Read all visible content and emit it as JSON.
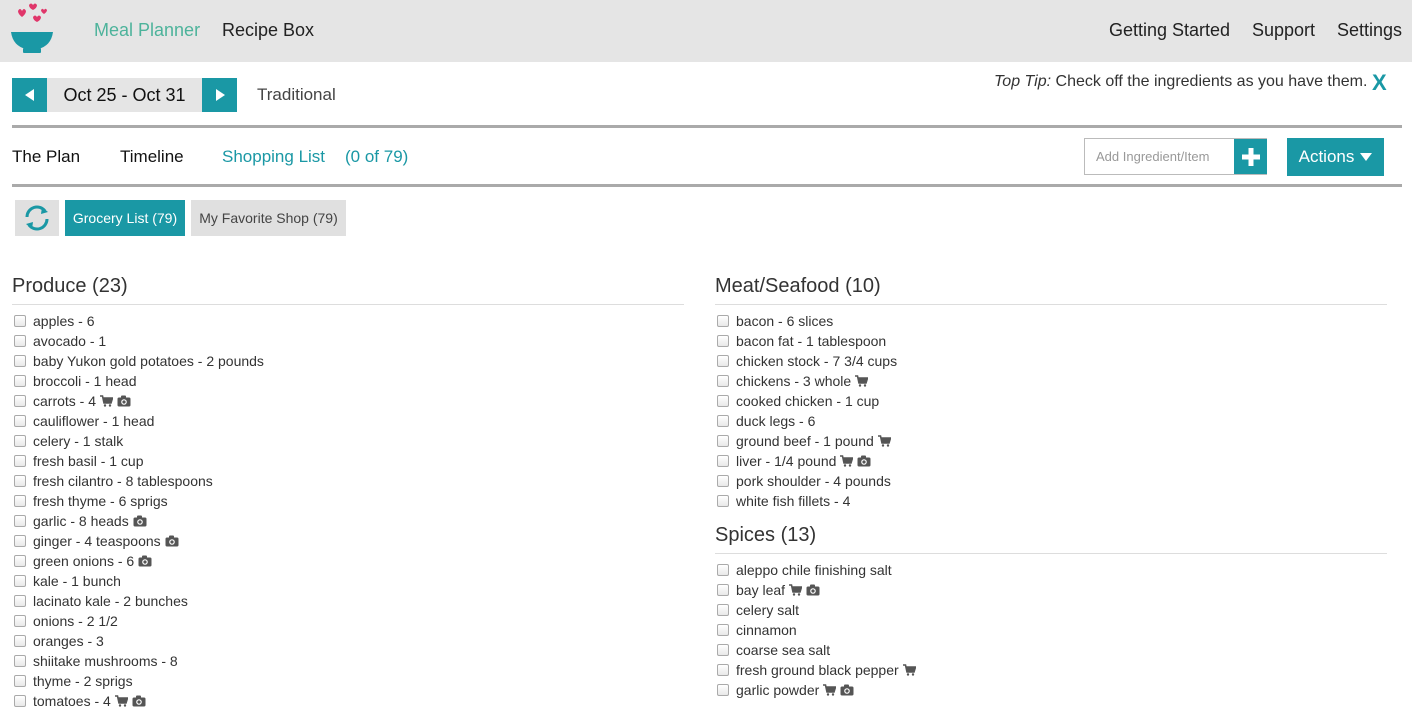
{
  "nav": {
    "meal_planner": "Meal Planner",
    "recipe_box": "Recipe Box",
    "getting_started": "Getting Started",
    "support": "Support",
    "settings": "Settings"
  },
  "week": {
    "range": "Oct 25 - Oct 31",
    "plan_type": "Traditional"
  },
  "tip": {
    "label": "Top Tip:",
    "text": "Check off the ingredients as you have them.",
    "close": "X"
  },
  "tabs": {
    "plan": "The Plan",
    "timeline": "Timeline",
    "shopping_list": "Shopping List",
    "shopping_count": "(0 of 79)"
  },
  "add_item": {
    "placeholder": "Add Ingredient/Item"
  },
  "actions": {
    "label": "Actions"
  },
  "filters": {
    "grocery": "Grocery List (79)",
    "shop": "My Favorite Shop (79)"
  },
  "colors": {
    "accent": "#1a98a5",
    "nav_active": "#4db39b",
    "heart": "#e0366a"
  },
  "sections": {
    "produce": {
      "title": "Produce (23)",
      "items": [
        {
          "text": "apples - 6",
          "cart": false,
          "camera": false
        },
        {
          "text": "avocado - 1",
          "cart": false,
          "camera": false
        },
        {
          "text": "baby Yukon gold potatoes - 2 pounds",
          "cart": false,
          "camera": false
        },
        {
          "text": "broccoli - 1 head",
          "cart": false,
          "camera": false
        },
        {
          "text": "carrots - 4",
          "cart": true,
          "camera": true
        },
        {
          "text": "cauliflower - 1 head",
          "cart": false,
          "camera": false
        },
        {
          "text": "celery - 1 stalk",
          "cart": false,
          "camera": false
        },
        {
          "text": "fresh basil - 1 cup",
          "cart": false,
          "camera": false
        },
        {
          "text": "fresh cilantro - 8 tablespoons",
          "cart": false,
          "camera": false
        },
        {
          "text": "fresh thyme - 6 sprigs",
          "cart": false,
          "camera": false
        },
        {
          "text": "garlic - 8 heads",
          "cart": false,
          "camera": true
        },
        {
          "text": "ginger - 4 teaspoons",
          "cart": false,
          "camera": true
        },
        {
          "text": "green onions - 6",
          "cart": false,
          "camera": true
        },
        {
          "text": "kale - 1 bunch",
          "cart": false,
          "camera": false
        },
        {
          "text": "lacinato kale - 2 bunches",
          "cart": false,
          "camera": false
        },
        {
          "text": "onions - 2 1/2",
          "cart": false,
          "camera": false
        },
        {
          "text": "oranges - 3",
          "cart": false,
          "camera": false
        },
        {
          "text": "shiitake mushrooms - 8",
          "cart": false,
          "camera": false
        },
        {
          "text": "thyme - 2 sprigs",
          "cart": false,
          "camera": false
        },
        {
          "text": "tomatoes - 4",
          "cart": true,
          "camera": true
        }
      ]
    },
    "meat": {
      "title": "Meat/Seafood (10)",
      "items": [
        {
          "text": "bacon - 6 slices",
          "cart": false,
          "camera": false
        },
        {
          "text": "bacon fat - 1 tablespoon",
          "cart": false,
          "camera": false
        },
        {
          "text": "chicken stock - 7 3/4 cups",
          "cart": false,
          "camera": false
        },
        {
          "text": "chickens - 3 whole",
          "cart": true,
          "camera": false
        },
        {
          "text": "cooked chicken - 1 cup",
          "cart": false,
          "camera": false
        },
        {
          "text": "duck legs - 6",
          "cart": false,
          "camera": false
        },
        {
          "text": "ground beef - 1 pound",
          "cart": true,
          "camera": false
        },
        {
          "text": "liver - 1/4 pound",
          "cart": true,
          "camera": true
        },
        {
          "text": "pork shoulder - 4 pounds",
          "cart": false,
          "camera": false
        },
        {
          "text": "white fish fillets - 4",
          "cart": false,
          "camera": false
        }
      ]
    },
    "spices": {
      "title": "Spices (13)",
      "items": [
        {
          "text": "aleppo chile finishing salt",
          "cart": false,
          "camera": false
        },
        {
          "text": "bay leaf",
          "cart": true,
          "camera": true
        },
        {
          "text": "celery salt",
          "cart": false,
          "camera": false
        },
        {
          "text": "cinnamon",
          "cart": false,
          "camera": false
        },
        {
          "text": "coarse sea salt",
          "cart": false,
          "camera": false
        },
        {
          "text": "fresh ground black pepper",
          "cart": true,
          "camera": false
        },
        {
          "text": "garlic powder",
          "cart": true,
          "camera": true
        }
      ]
    }
  }
}
